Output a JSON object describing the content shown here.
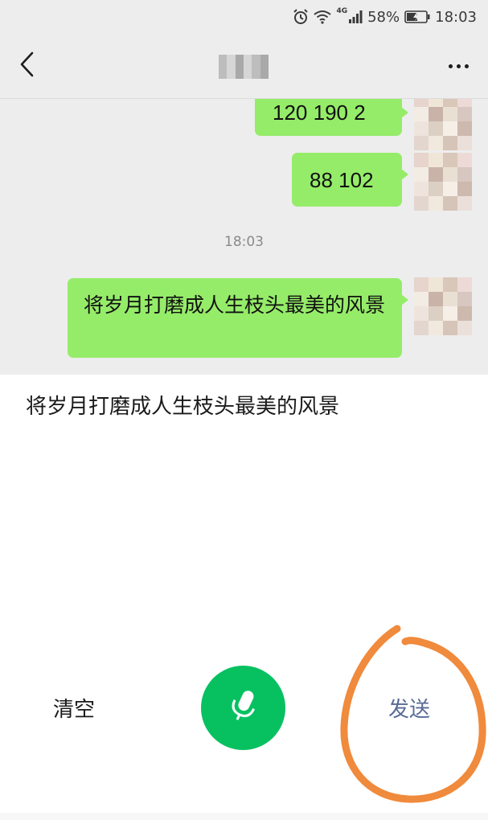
{
  "status_bar": {
    "network": "4G",
    "battery": "58%",
    "time": "18:03"
  },
  "header": {
    "back_icon": "chevron-left-icon",
    "more_icon": "more-dots-icon"
  },
  "messages": [
    {
      "sender": "self",
      "text": "120  190  2"
    },
    {
      "sender": "self",
      "text": "88  102"
    },
    {
      "sender": "self",
      "text": "将岁月打磨成人生枝头最美的风景"
    }
  ],
  "timestamp": "18:03",
  "voice_input": {
    "recognized_text": "将岁月打磨成人生枝头最美的风景",
    "clear_label": "清空",
    "send_label": "发送",
    "mic_icon": "microphone-icon"
  },
  "colors": {
    "bubble": "#95ec69",
    "mic_button": "#07c160",
    "send_text": "#576b95",
    "annotation": "#f08a3c",
    "chat_background": "#ededed"
  }
}
